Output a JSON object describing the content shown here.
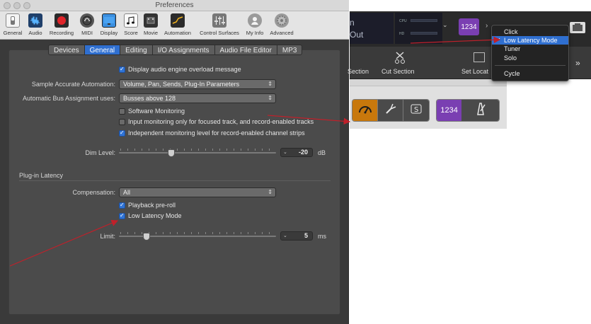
{
  "window": {
    "title": "Preferences"
  },
  "toolbar": {
    "items": [
      {
        "label": "General",
        "icon": "switch-icon"
      },
      {
        "label": "Audio",
        "icon": "waveform-icon"
      },
      {
        "label": "Recording",
        "icon": "record-icon"
      },
      {
        "label": "MIDI",
        "icon": "midi-port-icon"
      },
      {
        "label": "Display",
        "icon": "monitor-icon"
      },
      {
        "label": "Score",
        "icon": "score-icon"
      },
      {
        "label": "Movie",
        "icon": "film-icon"
      },
      {
        "label": "Automation",
        "icon": "automation-icon"
      },
      {
        "label": "Control Surfaces",
        "icon": "mixer-faders-icon"
      },
      {
        "label": "My Info",
        "icon": "user-icon"
      },
      {
        "label": "Advanced",
        "icon": "gear-icon"
      }
    ],
    "selected": "Audio"
  },
  "tabs": [
    "Devices",
    "General",
    "Editing",
    "I/O Assignments",
    "Audio File Editor",
    "MP3"
  ],
  "selected_tab": "General",
  "settings": {
    "overload_message": {
      "label": "Display audio engine overload message",
      "checked": true
    },
    "sample_accurate_automation": {
      "label": "Sample Accurate Automation:",
      "value": "Volume, Pan, Sends, Plug-In Parameters"
    },
    "bus_assignment": {
      "label": "Automatic Bus Assignment uses:",
      "value": "Busses above 128"
    },
    "software_monitoring": {
      "label": "Software Monitoring",
      "checked": false
    },
    "input_monitoring": {
      "label": "Input monitoring only for focused track, and record-enabled tracks",
      "checked": false
    },
    "independent_monitoring": {
      "label": "Independent monitoring level for record-enabled channel strips",
      "checked": true
    },
    "dim_level": {
      "label": "Dim Level:",
      "value": "-20",
      "unit": "dB",
      "slider_fraction": 0.33
    },
    "plugin_latency_heading": "Plug-in Latency",
    "compensation": {
      "label": "Compensation:",
      "value": "All"
    },
    "playback_preroll": {
      "label": "Playback pre-roll",
      "checked": true
    },
    "low_latency_mode": {
      "label": "Low Latency Mode",
      "checked": true
    },
    "limit": {
      "label": "Limit:",
      "value": "5",
      "unit": "ms",
      "slider_fraction": 0.17
    }
  },
  "control_bar": {
    "lcd_lines": [
      "n",
      "Out"
    ],
    "meters": [
      "CPU",
      "HD"
    ],
    "count_in_label": "1234",
    "tools": [
      "Section",
      "Cut Section",
      "Set Locat"
    ],
    "overflow": "»"
  },
  "dropdown_menu": {
    "items": [
      {
        "label": "Click",
        "checked": false
      },
      {
        "label": "Low Latency Mode",
        "checked": true
      },
      {
        "label": "Tuner",
        "checked": false
      },
      {
        "label": "Solo",
        "checked": false
      },
      {
        "label": "Cycle",
        "checked": false
      }
    ]
  },
  "button_group": {
    "buttons": [
      "speed-gauge-icon",
      "tuning-fork-icon",
      "solo-s-icon"
    ],
    "count_in_label": "1234",
    "metronome_icon": "metronome-icon"
  },
  "colors": {
    "accent_blue": "#2f6fd0",
    "annotation_red": "#c0202a",
    "orange_active": "#c8780c",
    "purple_badge": "#7a3fb2"
  }
}
